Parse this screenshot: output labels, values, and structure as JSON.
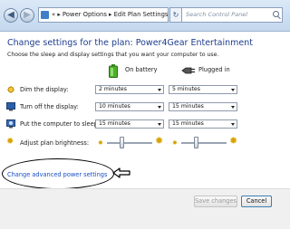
{
  "address_bar": {
    "breadcrumbs": [
      "«",
      "Power Options",
      "Edit Plan Settings"
    ],
    "search_placeholder": "Search Control Panel"
  },
  "main": {
    "title": "Change settings for the plan: Power4Gear Entertainment",
    "subtitle": "Choose the sleep and display settings that you want your computer to use.",
    "columns": [
      {
        "label": "On battery",
        "icon": "battery-icon"
      },
      {
        "label": "Plugged in",
        "icon": "plug-icon"
      }
    ],
    "rows": [
      {
        "label": "Dim the display:",
        "icon": "dim-display-icon",
        "on_battery": "2 minutes",
        "plugged_in": "5 minutes"
      },
      {
        "label": "Turn off the display:",
        "icon": "display-off-icon",
        "on_battery": "10 minutes",
        "plugged_in": "15 minutes"
      },
      {
        "label": "Put the computer to sleep:",
        "icon": "sleep-icon",
        "on_battery": "15 minutes",
        "plugged_in": "15 minutes"
      }
    ],
    "brightness": {
      "label": "Adjust plan brightness:",
      "on_battery_level": 0.3,
      "plugged_in_level": 0.3
    },
    "advanced_link": "Change advanced power settings"
  },
  "footer": {
    "save_label": "Save changes",
    "cancel_label": "Cancel"
  },
  "colors": {
    "title": "#1e3d8f",
    "link": "#1a4ec2",
    "battery": "#4caf2a",
    "sun": "#d8a300"
  }
}
